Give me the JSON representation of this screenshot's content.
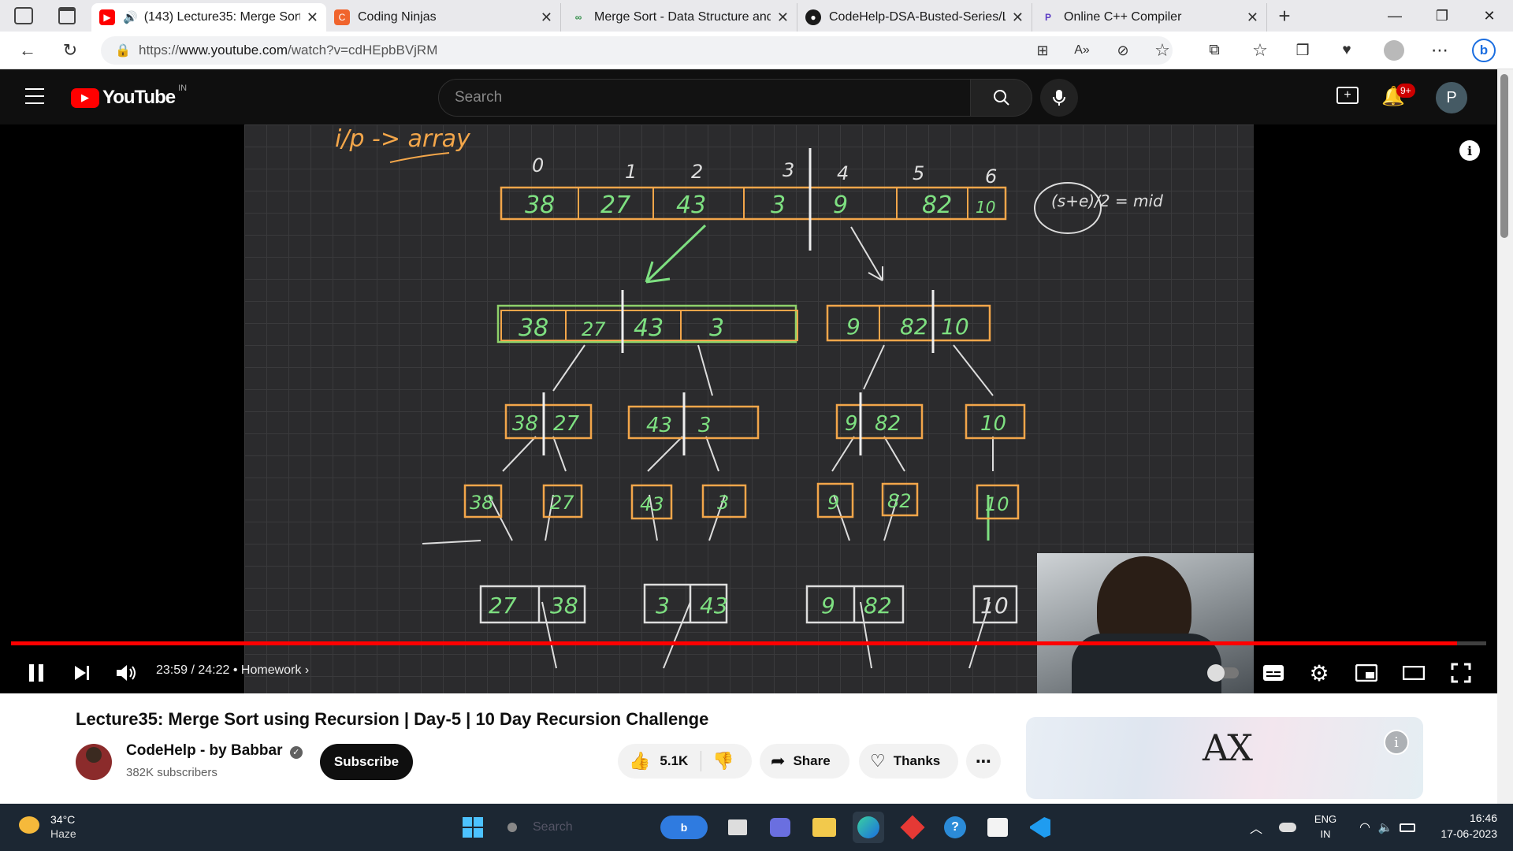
{
  "browser": {
    "tabs": [
      {
        "title": "(143) Lecture35: Merge Sort",
        "icon": "youtube-icon",
        "active": true
      },
      {
        "title": "Coding Ninjas",
        "icon": "coding-ninjas-icon"
      },
      {
        "title": "Merge Sort - Data Structure and",
        "icon": "geeksforgeeks-icon"
      },
      {
        "title": "CodeHelp-DSA-Busted-Series/Le",
        "icon": "github-icon"
      },
      {
        "title": "Online C++ Compiler",
        "icon": "programiz-icon"
      }
    ],
    "url_prefix": "https://",
    "url_host": "www.youtube.com",
    "url_path": "/watch?v=cdHEpbBVjRM"
  },
  "youtube": {
    "logo_text": "YouTube",
    "region": "IN",
    "search_placeholder": "Search",
    "notifications_badge": "9+",
    "profile_initial": "P"
  },
  "whiteboard": {
    "heading": "i/p -> array",
    "indices": [
      "0",
      "1",
      "2",
      "3",
      "4",
      "5",
      "6"
    ],
    "array": [
      "38",
      "27",
      "43",
      "3",
      "9",
      "82",
      "10"
    ],
    "mid_formula": "(s+e)/2 = mid",
    "level1_left": [
      "38",
      "27",
      "43",
      "3"
    ],
    "level1_right": [
      "9",
      "82",
      "10"
    ],
    "level2": [
      [
        "38",
        "27"
      ],
      [
        "43",
        "3"
      ],
      [
        "9",
        "82"
      ],
      [
        "10"
      ]
    ],
    "level3": [
      "38",
      "27",
      "43",
      "3",
      "9",
      "82",
      "10"
    ],
    "merged": [
      [
        "27",
        "38"
      ],
      [
        "3",
        "43"
      ],
      [
        "9",
        "82"
      ],
      [
        "10"
      ]
    ]
  },
  "player": {
    "progress_percent": 98,
    "time": "23:59 / 24:22",
    "chapter": "Homework",
    "accent": "#ff0000"
  },
  "video": {
    "title": "Lecture35: Merge Sort using Recursion | Day-5 | 10 Day Recursion Challenge",
    "channel": "CodeHelp - by Babbar",
    "subscribers": "382K subscribers",
    "subscribe_label": "Subscribe",
    "likes": "5.1K",
    "share_label": "Share",
    "thanks_label": "Thanks",
    "ad_brand": "AX"
  },
  "taskbar": {
    "temperature": "34°C",
    "weather": "Haze",
    "search_placeholder": "Search",
    "lang_top": "ENG",
    "lang_bottom": "IN",
    "time": "16:46",
    "date": "17-06-2023"
  }
}
